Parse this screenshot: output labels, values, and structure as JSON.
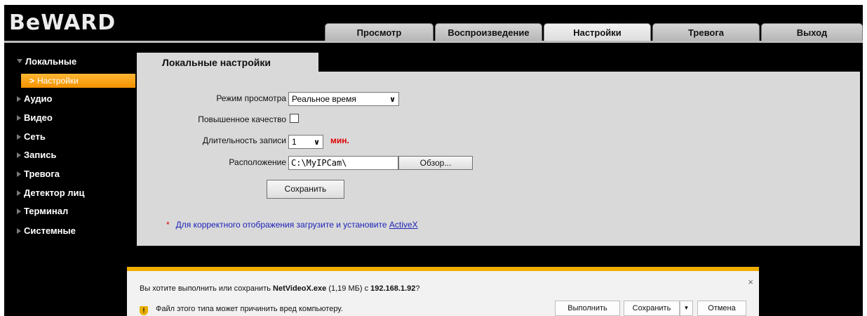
{
  "logo": "BeWARD",
  "nav": {
    "tabs": [
      "Просмотр",
      "Воспроизведение",
      "Настройки",
      "Тревога",
      "Выход"
    ],
    "active": "Настройки"
  },
  "sidebar": {
    "items": [
      "Локальные",
      "Аудио",
      "Видео",
      "Сеть",
      "Запись",
      "Тревога",
      "Детектор лиц",
      "Терминал",
      "Системные"
    ],
    "sub_items": [
      "Настройки"
    ]
  },
  "content": {
    "tab_title": "Локальные настройки",
    "view_mode": {
      "label": "Режим просмотра",
      "value": "Реальное время"
    },
    "high_quality": {
      "label": "Повышенное качество",
      "checked": false
    },
    "record_duration": {
      "label": "Длительность записи",
      "value": "1",
      "unit": "мин."
    },
    "location": {
      "label": "Расположение",
      "value": "C:\\MyIPCam\\",
      "browse_label": "Обзор..."
    },
    "save_label": "Сохранить",
    "note": {
      "star": "*",
      "text": "Для корректного отображения загрузите и установите ",
      "link": "ActiveX"
    }
  },
  "download_bar": {
    "question_prefix": "Вы хотите выполнить или сохранить ",
    "file_name": "NetVideoX.exe",
    "size": "(1,19 МБ)",
    "from": "с",
    "host": "192.168.1.92",
    "question_suffix": "?",
    "warning": "Файл этого типа может причинить вред компьютеру.",
    "run_label": "Выполнить",
    "save_label": "Сохранить",
    "cancel_label": "Отмена",
    "close_glyph": "×",
    "dropdown_glyph": "▼",
    "shield_glyph": "!"
  },
  "colors": {
    "accent": "#f39200",
    "panel": "#d9d9d9",
    "warning_bar": "#f0ae00",
    "link": "#1e22b8",
    "unit_red": "#e00000"
  },
  "icons": {
    "sidebar_expand": "triangle-right-icon",
    "sidebar_open": "triangle-down-icon",
    "submenu": "chevron-right-icon",
    "select": "chevron-down-icon",
    "shield": "shield-warning-icon",
    "close": "close-icon"
  }
}
